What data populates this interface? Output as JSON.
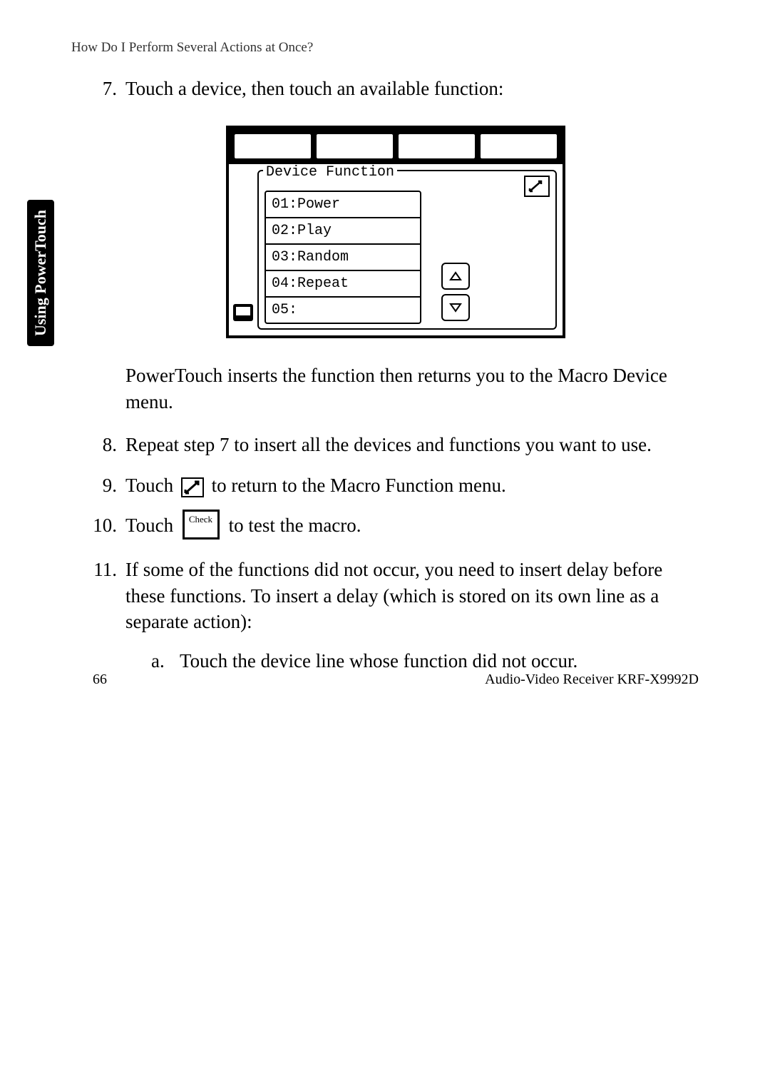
{
  "header": "How Do I Perform Several Actions at Once?",
  "side_tab": "Using PowerTouch",
  "steps": {
    "s7": {
      "num": "7.",
      "text": "Touch a device, then touch an available function:"
    },
    "s7_para": "PowerTouch inserts the function then returns you to the Macro Device menu.",
    "s8": {
      "num": "8.",
      "text": "Repeat step 7 to insert all the devices and functions you want to use."
    },
    "s9": {
      "num": "9.",
      "pre": "Touch ",
      "post": " to return to the Macro Function menu."
    },
    "s10": {
      "num": "10.",
      "pre": "Touch ",
      "post": " to test the macro."
    },
    "s11": {
      "num": "11.",
      "text": "If some of the functions did not occur, you need to insert delay before these functions. To insert a delay (which is stored on its own line as a separate action):"
    },
    "s11a": {
      "letter": "a.",
      "text": "Touch the device line whose function did not occur."
    }
  },
  "check_label": "Check",
  "screenshot": {
    "title": "Device Function",
    "items": [
      "01:Power",
      "02:Play",
      "03:Random",
      "04:Repeat",
      "05:"
    ]
  },
  "footer": {
    "page": "66",
    "product": "Audio-Video Receiver KRF-X9992D"
  }
}
